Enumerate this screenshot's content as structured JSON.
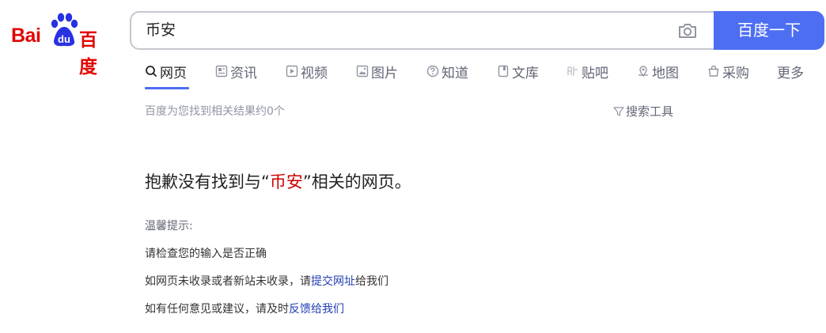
{
  "logo": {
    "text_left": "Bai",
    "text_paw": "du",
    "text_cn": "百度"
  },
  "search": {
    "query": "币安",
    "button_label": "百度一下"
  },
  "tabs": [
    {
      "label": "网页",
      "icon": "search-icon",
      "active": true
    },
    {
      "label": "资讯",
      "icon": "news-icon"
    },
    {
      "label": "视频",
      "icon": "video-icon"
    },
    {
      "label": "图片",
      "icon": "image-icon"
    },
    {
      "label": "知道",
      "icon": "question-icon"
    },
    {
      "label": "文库",
      "icon": "document-icon"
    },
    {
      "label": "贴吧",
      "icon": "tieba-icon"
    },
    {
      "label": "地图",
      "icon": "map-icon"
    },
    {
      "label": "采购",
      "icon": "shopping-icon"
    },
    {
      "label": "更多"
    }
  ],
  "results": {
    "count_text": "百度为您找到相关结果约0个",
    "tools_label": "搜索工具"
  },
  "no_result": {
    "prefix": "抱歉没有找到与“",
    "keyword": "币安",
    "suffix": "”相关的网页。"
  },
  "tips": {
    "title": "温馨提示:",
    "line1": "请检查您的输入是否正确",
    "line2_prefix": "如网页未收录或者新站未收录，请",
    "line2_link": "提交网址",
    "line2_suffix": "给我们",
    "line3_prefix": "如有任何意见或建议，请及时",
    "line3_link": "反馈给我们"
  },
  "colors": {
    "brand_red": "#e10601",
    "brand_blue": "#2932e1",
    "button_blue": "#4e6ef2",
    "link_blue": "#2440b3",
    "keyword_red": "#cc0000"
  }
}
